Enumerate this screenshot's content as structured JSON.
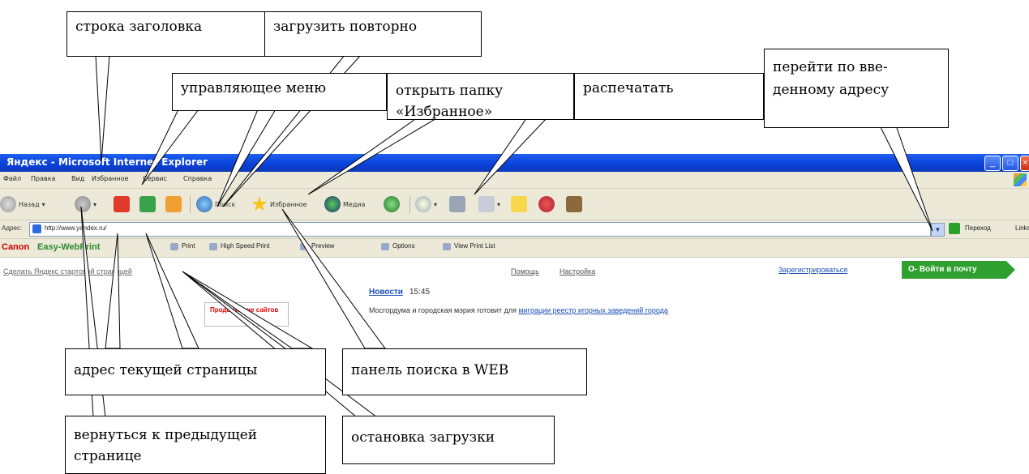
{
  "browser": {
    "window_title": "Яндекс - Microsoft Internet Explorer",
    "menu": [
      "Файл",
      "Правка",
      "Вид",
      "Избранное",
      "Сервис",
      "Справка"
    ],
    "toolbar": {
      "back": "Назад",
      "search": "Поиск",
      "favorites": "Избранное",
      "media": "Медиа"
    },
    "address": {
      "label": "Адрес:",
      "url": "http://www.yandex.ru/",
      "go": "Переход",
      "links": "Links"
    },
    "printbar": {
      "brand": "Canon",
      "product": "Easy-WebPrint",
      "buttons": [
        "Print",
        "High Speed Print",
        "Preview",
        "Options",
        "View Print List"
      ]
    },
    "page": {
      "left_link": "Сделать Яндекс стартовой страницей",
      "help": "Помощь",
      "settings": "Настройка",
      "register": "Зарегистрироваться",
      "mail_button": "Войти в почту",
      "promo": "Продвижение сайтов",
      "news_title": "Новости",
      "news_time": "15:45",
      "news_text": "Мосгордума и городская мэрия готовит для ",
      "news_link": "миграции реестр игорных заведений города"
    },
    "colors": {
      "titlebar": "#0a40d8",
      "chrome": "#ece9d8",
      "link": "#1a4fb5",
      "mail_button": "#2fa02f"
    }
  },
  "callouts": {
    "title_bar": "строка заголовка",
    "reload": "загрузить повторно",
    "control_menu": "управляющее меню",
    "favorites": "открыть папку\n«Избранное»",
    "print": "распечатать",
    "go_address": "перейти по вве-\nденному адресу",
    "current_address": "адрес текущей страницы",
    "web_search": "панель поиска в WEB",
    "go_back": "вернуться к предыдущей\nстранице",
    "stop": "остановка загрузки"
  }
}
